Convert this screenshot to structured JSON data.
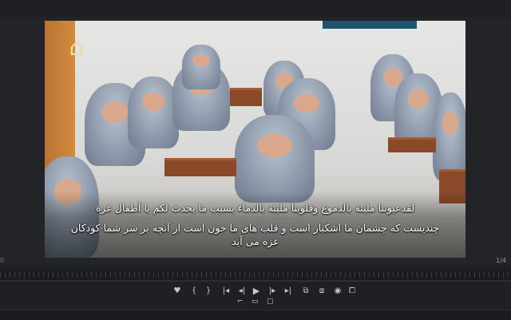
{
  "video": {
    "subtitle_arabic": "لقدعيوننا مليئة بالدموع وقلوبنا مليئة بالدماء بسبب ما يحدث لكم يا أطفال غزة",
    "subtitle_persian_line1": "چندیست که چشمان ما اشکبار است و قلب های ما خون است از آنچه بر سر شما کودکان",
    "subtitle_persian_line2": "غزه می آید",
    "logo_icon": "arches-logo-icon"
  },
  "viewer": {
    "frame_indicator": "1/4",
    "left_marker": "0"
  },
  "timeline": {
    "progress": 0.0
  },
  "controls": {
    "mark_label": "♥",
    "mark_in_label": "{",
    "mark_out_label": "}",
    "go_to_in_label": "|◂",
    "step_back_label": "◂|",
    "rewind_label": "◂",
    "play_label": "▶",
    "forward_label": "▸",
    "step_forward_label": "|▸",
    "go_to_out_label": "▸|",
    "insert_label": "⧉",
    "overwrite_label": "⧈",
    "camera_label": "◉",
    "export_frame_label": "⧠",
    "row2_trim_label": "⌐",
    "row2_safe_label": "▭",
    "row2_overlay_label": "▢"
  },
  "colors": {
    "background": "#1f2023",
    "viewer": "#232428",
    "control_text": "#c8c8cc"
  }
}
